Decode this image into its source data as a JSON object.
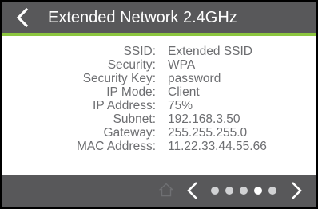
{
  "header": {
    "title": "Extended Network 2.4GHz"
  },
  "colors": {
    "header_bg": "#58585a",
    "accent": "#8cc63f",
    "text": "#6d6e71",
    "footer_bg": "#58585a"
  },
  "icons": {
    "back": "chevron-left-icon",
    "home": "home-icon",
    "prev": "chevron-left-icon",
    "next": "chevron-right-icon"
  },
  "details": [
    {
      "label": "SSID:",
      "value": "Extended SSID"
    },
    {
      "label": "Security:",
      "value": "WPA"
    },
    {
      "label": "Security Key:",
      "value": "password"
    },
    {
      "label": "IP Mode:",
      "value": "Client"
    },
    {
      "label": "IP Address:",
      "value": "75%"
    },
    {
      "label": "Subnet:",
      "value": "192.168.3.50"
    },
    {
      "label": "Gateway:",
      "value": "255.255.255.0"
    },
    {
      "label": "MAC Address:",
      "value": "11.22.33.44.55.66"
    }
  ],
  "pagination": {
    "total_pages": 5,
    "active_page": 4
  }
}
